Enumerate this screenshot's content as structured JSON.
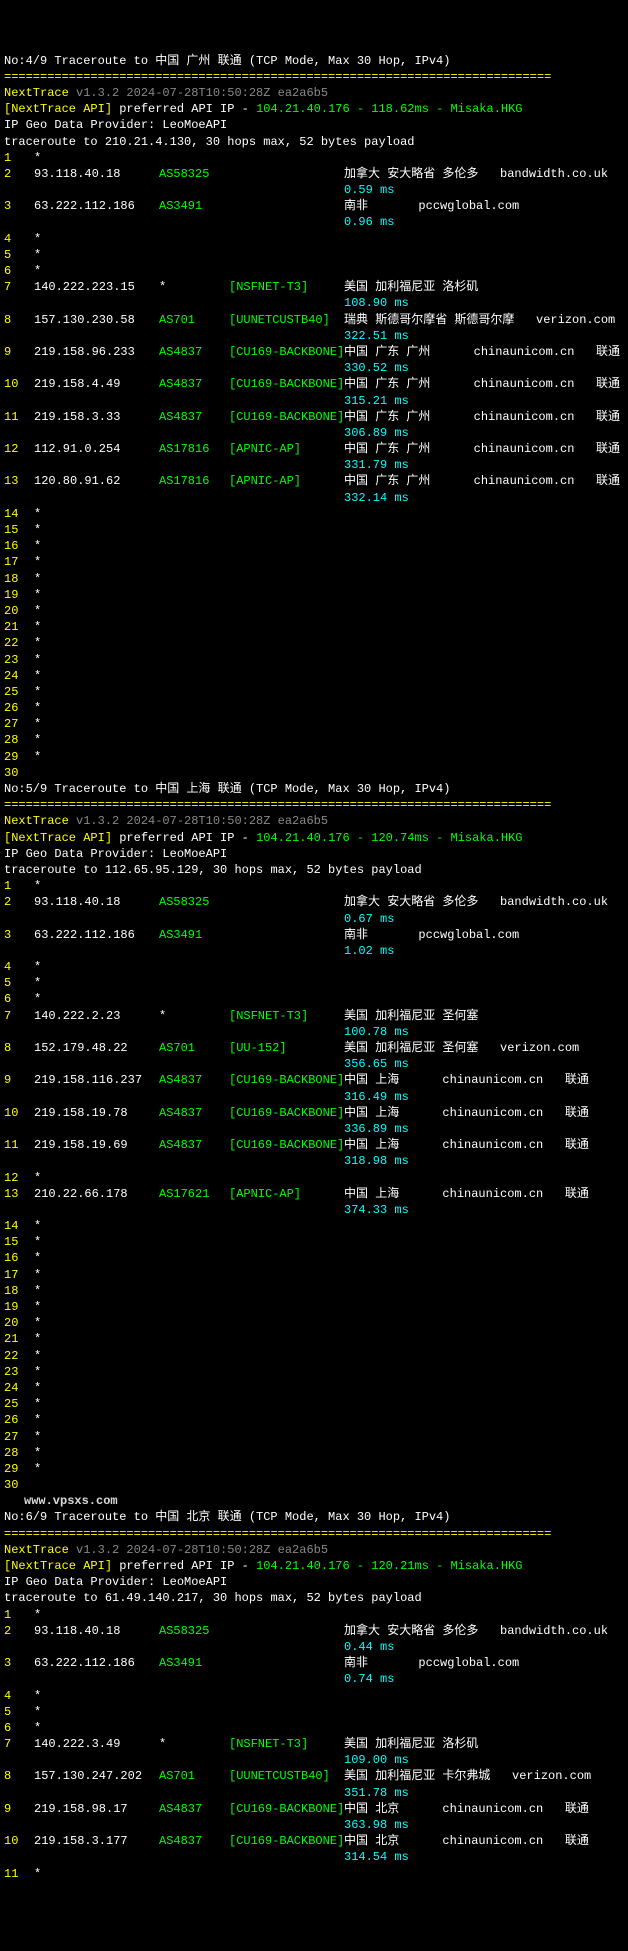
{
  "sections": [
    {
      "header": "No:4/9 Traceroute to 中国 广州 联通 (TCP Mode, Max 30 Hop, IPv4)",
      "sep": "============================================================================",
      "nexttrace": "NextTrace",
      "ver": "v1.3.2 2024-07-28T10:50:28Z ea2a6b5",
      "apiLabel": "[NextTrace API]",
      "apiText": " preferred API IP - ",
      "apiIp": "104.21.40.176 - 118.62ms - Misaka.HKG",
      "geo": "IP Geo Data Provider: LeoMoeAPI",
      "trace": "traceroute to 210.21.4.130, 30 hops max, 52 bytes payload",
      "hops": [
        {
          "n": "1",
          "star": "*"
        },
        {
          "n": "2",
          "ip": "93.118.40.18",
          "asn": "AS58325",
          "loc": "加拿大 安大略省 多伦多",
          "host": "bandwidth.co.uk",
          "lat": "0.59 ms"
        },
        {
          "n": "3",
          "ip": "63.222.112.186",
          "asn": "AS3491",
          "loc": "南非",
          "host": "pccwglobal.com",
          "lat": "0.96 ms",
          "locPad": "    "
        },
        {
          "n": "4",
          "star": "*"
        },
        {
          "n": "5",
          "star": "*"
        },
        {
          "n": "6",
          "star": "*"
        },
        {
          "n": "7",
          "ip": "140.222.223.15",
          "asn": "*",
          "asnWhite": true,
          "bracket": "[NSFNET-T3]",
          "loc": "美国 加利福尼亚 洛杉矶",
          "lat": "108.90 ms"
        },
        {
          "n": "8",
          "ip": "157.130.230.58",
          "asn": "AS701",
          "bracket": "[UUNETCUSTB40]",
          "loc": "瑞典 斯德哥尔摩省 斯德哥尔摩",
          "host": "verizon.com",
          "lat": "322.51 ms"
        },
        {
          "n": "9",
          "ip": "219.158.96.233",
          "asn": "AS4837",
          "bracket": "[CU169-BACKBONE]",
          "loc": "中国 广东 广州",
          "host": "chinaunicom.cn",
          "extra": "联通",
          "lat": "330.52 ms",
          "locPad": "   "
        },
        {
          "n": "10",
          "ip": "219.158.4.49",
          "asn": "AS4837",
          "bracket": "[CU169-BACKBONE]",
          "loc": "中国 广东 广州",
          "host": "chinaunicom.cn",
          "extra": "联通",
          "lat": "315.21 ms",
          "locPad": "   "
        },
        {
          "n": "11",
          "ip": "219.158.3.33",
          "asn": "AS4837",
          "bracket": "[CU169-BACKBONE]",
          "loc": "中国 广东 广州",
          "host": "chinaunicom.cn",
          "extra": "联通",
          "lat": "306.89 ms",
          "locPad": "   "
        },
        {
          "n": "12",
          "ip": "112.91.0.254",
          "asn": "AS17816",
          "bracket": "[APNIC-AP]",
          "loc": "中国 广东 广州",
          "host": "chinaunicom.cn",
          "extra": "联通",
          "lat": "331.79 ms",
          "locPad": "   "
        },
        {
          "n": "13",
          "ip": "120.80.91.62",
          "asn": "AS17816",
          "bracket": "[APNIC-AP]",
          "loc": "中国 广东 广州",
          "host": "chinaunicom.cn",
          "extra": "联通",
          "lat": "332.14 ms",
          "locPad": "   "
        },
        {
          "n": "14",
          "star": "*"
        },
        {
          "n": "15",
          "star": "*"
        },
        {
          "n": "16",
          "star": "*"
        },
        {
          "n": "17",
          "star": "*"
        },
        {
          "n": "18",
          "star": "*"
        },
        {
          "n": "19",
          "star": "*"
        },
        {
          "n": "20",
          "star": "*"
        },
        {
          "n": "21",
          "star": "*"
        },
        {
          "n": "22",
          "star": "*"
        },
        {
          "n": "23",
          "star": "*"
        },
        {
          "n": "24",
          "star": "*"
        },
        {
          "n": "25",
          "star": "*"
        },
        {
          "n": "26",
          "star": "*"
        },
        {
          "n": "27",
          "star": "*"
        },
        {
          "n": "28",
          "star": "*"
        },
        {
          "n": "29",
          "star": "*"
        },
        {
          "n": "30",
          "star": ""
        }
      ]
    },
    {
      "header": "No:5/9 Traceroute to 中国 上海 联通 (TCP Mode, Max 30 Hop, IPv4)",
      "sep": "============================================================================",
      "nexttrace": "NextTrace",
      "ver": "v1.3.2 2024-07-28T10:50:28Z ea2a6b5",
      "apiLabel": "[NextTrace API]",
      "apiText": " preferred API IP - ",
      "apiIp": "104.21.40.176 - 120.74ms - Misaka.HKG",
      "geo": "IP Geo Data Provider: LeoMoeAPI",
      "trace": "traceroute to 112.65.95.129, 30 hops max, 52 bytes payload",
      "hops": [
        {
          "n": "1",
          "star": "*"
        },
        {
          "n": "2",
          "ip": "93.118.40.18",
          "asn": "AS58325",
          "loc": "加拿大 安大略省 多伦多",
          "host": "bandwidth.co.uk",
          "lat": "0.67 ms"
        },
        {
          "n": "3",
          "ip": "63.222.112.186",
          "asn": "AS3491",
          "loc": "南非",
          "host": "pccwglobal.com",
          "lat": "1.02 ms",
          "locPad": "    "
        },
        {
          "n": "4",
          "star": "*"
        },
        {
          "n": "5",
          "star": "*"
        },
        {
          "n": "6",
          "star": "*"
        },
        {
          "n": "7",
          "ip": "140.222.2.23",
          "asn": "*",
          "asnWhite": true,
          "bracket": "[NSFNET-T3]",
          "loc": "美国 加利福尼亚 圣何塞",
          "lat": "100.78 ms"
        },
        {
          "n": "8",
          "ip": "152.179.48.22",
          "asn": "AS701",
          "bracket": "[UU-152]",
          "loc": "美国 加利福尼亚 圣何塞",
          "host": "verizon.com",
          "lat": "356.65 ms"
        },
        {
          "n": "9",
          "ip": "219.158.116.237",
          "asn": "AS4837",
          "bracket": "[CU169-BACKBONE]",
          "loc": "中国 上海",
          "host": "chinaunicom.cn",
          "extra": "联通",
          "lat": "316.49 ms",
          "locPad": "   "
        },
        {
          "n": "10",
          "ip": "219.158.19.78",
          "asn": "AS4837",
          "bracket": "[CU169-BACKBONE]",
          "loc": "中国 上海",
          "host": "chinaunicom.cn",
          "extra": "联通",
          "lat": "336.89 ms",
          "locPad": "   "
        },
        {
          "n": "11",
          "ip": "219.158.19.69",
          "asn": "AS4837",
          "bracket": "[CU169-BACKBONE]",
          "loc": "中国 上海",
          "host": "chinaunicom.cn",
          "extra": "联通",
          "lat": "318.98 ms",
          "locPad": "   "
        },
        {
          "n": "12",
          "star": "*"
        },
        {
          "n": "13",
          "ip": "210.22.66.178",
          "asn": "AS17621",
          "bracket": "[APNIC-AP]",
          "loc": "中国 上海",
          "host": "chinaunicom.cn",
          "extra": "联通",
          "lat": "374.33 ms",
          "locPad": "   "
        },
        {
          "n": "14",
          "star": "*"
        },
        {
          "n": "15",
          "star": "*"
        },
        {
          "n": "16",
          "star": "*"
        },
        {
          "n": "17",
          "star": "*"
        },
        {
          "n": "18",
          "star": "*"
        },
        {
          "n": "19",
          "star": "*"
        },
        {
          "n": "20",
          "star": "*"
        },
        {
          "n": "21",
          "star": "*"
        },
        {
          "n": "22",
          "star": "*"
        },
        {
          "n": "23",
          "star": "*"
        },
        {
          "n": "24",
          "star": "*"
        },
        {
          "n": "25",
          "star": "*"
        },
        {
          "n": "26",
          "star": "*"
        },
        {
          "n": "27",
          "star": "*"
        },
        {
          "n": "28",
          "star": "*"
        },
        {
          "n": "29",
          "star": "*"
        },
        {
          "n": "30",
          "star": ""
        }
      ],
      "watermark": "www.vpsxs.com"
    },
    {
      "header": "No:6/9 Traceroute to 中国 北京 联通 (TCP Mode, Max 30 Hop, IPv4)",
      "sep": "============================================================================",
      "nexttrace": "NextTrace",
      "ver": "v1.3.2 2024-07-28T10:50:28Z ea2a6b5",
      "apiLabel": "[NextTrace API]",
      "apiText": " preferred API IP - ",
      "apiIp": "104.21.40.176 - 120.21ms - Misaka.HKG",
      "geo": "IP Geo Data Provider: LeoMoeAPI",
      "trace": "traceroute to 61.49.140.217, 30 hops max, 52 bytes payload",
      "hops": [
        {
          "n": "1",
          "star": "*"
        },
        {
          "n": "2",
          "ip": "93.118.40.18",
          "asn": "AS58325",
          "loc": "加拿大 安大略省 多伦多",
          "host": "bandwidth.co.uk",
          "lat": "0.44 ms"
        },
        {
          "n": "3",
          "ip": "63.222.112.186",
          "asn": "AS3491",
          "loc": "南非",
          "host": "pccwglobal.com",
          "lat": "0.74 ms",
          "locPad": "    "
        },
        {
          "n": "4",
          "star": "*"
        },
        {
          "n": "5",
          "star": "*"
        },
        {
          "n": "6",
          "star": "*"
        },
        {
          "n": "7",
          "ip": "140.222.3.49",
          "asn": "*",
          "asnWhite": true,
          "bracket": "[NSFNET-T3]",
          "loc": "美国 加利福尼亚 洛杉矶",
          "lat": "109.00 ms"
        },
        {
          "n": "8",
          "ip": "157.130.247.202",
          "asn": "AS701",
          "bracket": "[UUNETCUSTB40]",
          "loc": "美国 加利福尼亚 卡尔弗城",
          "host": "verizon.com",
          "lat": "351.78 ms"
        },
        {
          "n": "9",
          "ip": "219.158.98.17",
          "asn": "AS4837",
          "bracket": "[CU169-BACKBONE]",
          "loc": "中国 北京",
          "host": "chinaunicom.cn",
          "extra": "联通",
          "lat": "363.98 ms",
          "locPad": "   "
        },
        {
          "n": "10",
          "ip": "219.158.3.177",
          "asn": "AS4837",
          "bracket": "[CU169-BACKBONE]",
          "loc": "中国 北京",
          "host": "chinaunicom.cn",
          "extra": "联通",
          "lat": "314.54 ms",
          "locPad": "   "
        },
        {
          "n": "11",
          "star": "*"
        }
      ]
    }
  ]
}
